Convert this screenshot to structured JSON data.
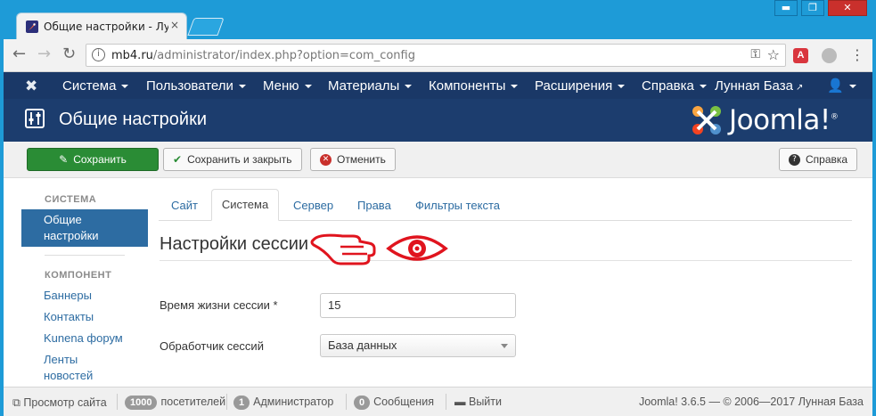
{
  "browser": {
    "tab_title": "Общие настройки - Лунная База",
    "tab_close": "×",
    "window_buttons": [
      "▬",
      "❐",
      "✕"
    ],
    "url_host": "mb4.ru",
    "url_path": "/administrator/index.php?option=com_config",
    "icons": [
      "back-arrow",
      "forward-arrow",
      "reload",
      "info",
      "key",
      "star",
      "pdf-extension",
      "extension",
      "menu-dots"
    ]
  },
  "nav": {
    "items": [
      "Система",
      "Пользователи",
      "Меню",
      "Материалы",
      "Компоненты",
      "Расширения",
      "Справка"
    ],
    "site_link": "Лунная База"
  },
  "header": {
    "title": "Общие настройки",
    "brand": "Joomla!"
  },
  "toolbar": {
    "save": "Сохранить",
    "save_close": "Сохранить и закрыть",
    "cancel": "Отменить",
    "help": "Справка"
  },
  "sidebar": {
    "system_heading": "СИСТЕМА",
    "active_line1": "Общие",
    "active_line2": "настройки",
    "component_heading": "КОМПОНЕНТ",
    "links": [
      "Баннеры",
      "Контакты",
      "Kunena форум",
      "Ленты",
      "новостей"
    ]
  },
  "tabs": [
    "Сайт",
    "Система",
    "Сервер",
    "Права",
    "Фильтры текста"
  ],
  "section": {
    "title": "Настройки сессии"
  },
  "fields": {
    "lifetime_label": "Время жизни сессии *",
    "lifetime_value": "15",
    "handler_label": "Обработчик сессий",
    "handler_value": "База данных"
  },
  "status": {
    "view_site": "Просмотр сайта",
    "visitors_count": "1000",
    "visitors_label": "посетителей",
    "admin_count": "1",
    "admin_label": "Администратор",
    "messages_count": "0",
    "messages_label": "Сообщения",
    "logout": "Выйти",
    "footer": "Joomla! 3.6.5 — © 2006—2017 Лунная База"
  },
  "colors": {
    "chrome": "#1e9bd7",
    "nav": "#1a3867",
    "header": "#1c3d6e",
    "save": "#2a8c35",
    "link": "#2d6ca2",
    "annotation": "#e0141e"
  }
}
